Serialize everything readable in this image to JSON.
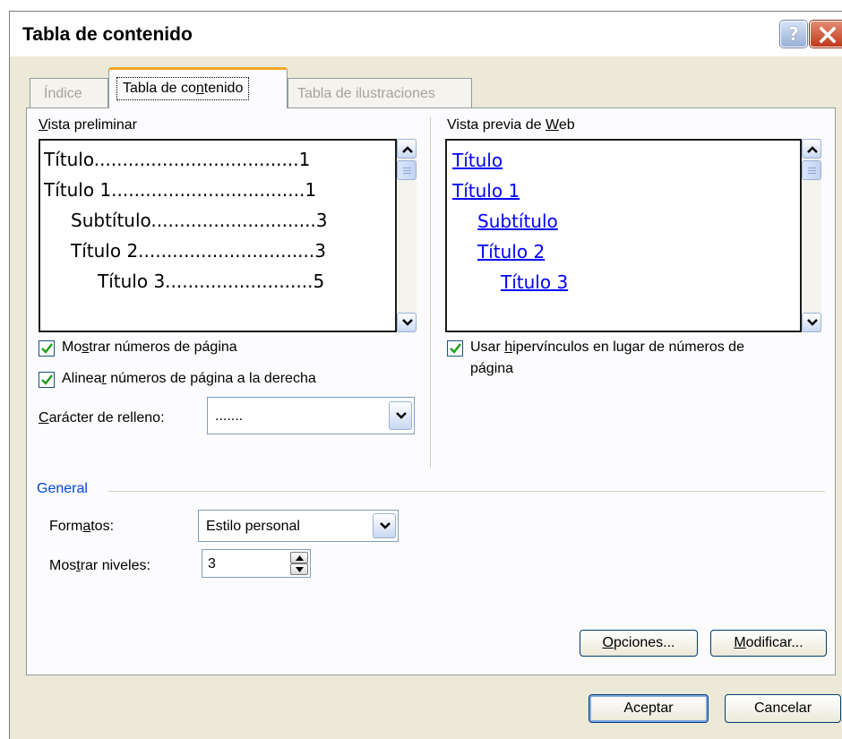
{
  "dialog": {
    "title": "Tabla de contenido",
    "help_label": "?"
  },
  "tabs": [
    {
      "label": "Índice"
    },
    {
      "label": "Tabla de contenido"
    },
    {
      "label": "Tabla de ilustraciones"
    }
  ],
  "print_preview": {
    "label_u": "V",
    "label_rest": "ista preliminar",
    "entries": [
      {
        "text": "Título....................................1"
      },
      {
        "text": "Título 1..................................1"
      },
      {
        "text": "Subtítulo.............................3"
      },
      {
        "text": "Título 2...............................3"
      },
      {
        "text": "Título 3..........................5"
      }
    ]
  },
  "web_preview": {
    "label_pre": "Vista previa de ",
    "label_u": "W",
    "label_post": "eb",
    "links": [
      {
        "text": "Título"
      },
      {
        "text": "Título 1"
      },
      {
        "text": "Subtítulo"
      },
      {
        "text": "Título 2"
      },
      {
        "text": "Título 3"
      }
    ]
  },
  "options": {
    "show_page_numbers": {
      "pre": "Mo",
      "u": "s",
      "post": "trar números de página",
      "checked": true
    },
    "align_right": {
      "pre": "Alinea",
      "u": "r",
      "post": " números de página a la derecha",
      "checked": true
    },
    "use_hyperlinks": {
      "pre": "Usar ",
      "u": "h",
      "post": "ipervínculos en lugar de números de",
      "line2": "página",
      "checked": true
    },
    "tab_leader": {
      "u": "C",
      "rest": "arácter de relleno:",
      "value": "......."
    }
  },
  "general": {
    "legend": "General",
    "formats_pre": "Form",
    "formats_u": "a",
    "formats_post": "tos:",
    "formats_value": "Estilo personal",
    "levels_pre": "Mos",
    "levels_u": "t",
    "levels_post": "rar niveles:",
    "levels_value": "3"
  },
  "buttons": {
    "options_u": "O",
    "options_rest": "pciones...",
    "modify_u": "M",
    "modify_rest": "odificar...",
    "ok": "Aceptar",
    "cancel": "Cancelar"
  },
  "colors": {
    "link": "#0000ff",
    "legend": "#0046d5",
    "tab_highlight": "#f5a623",
    "dialog_bg": "#ECE9D8",
    "close_button": "#c0391b"
  }
}
